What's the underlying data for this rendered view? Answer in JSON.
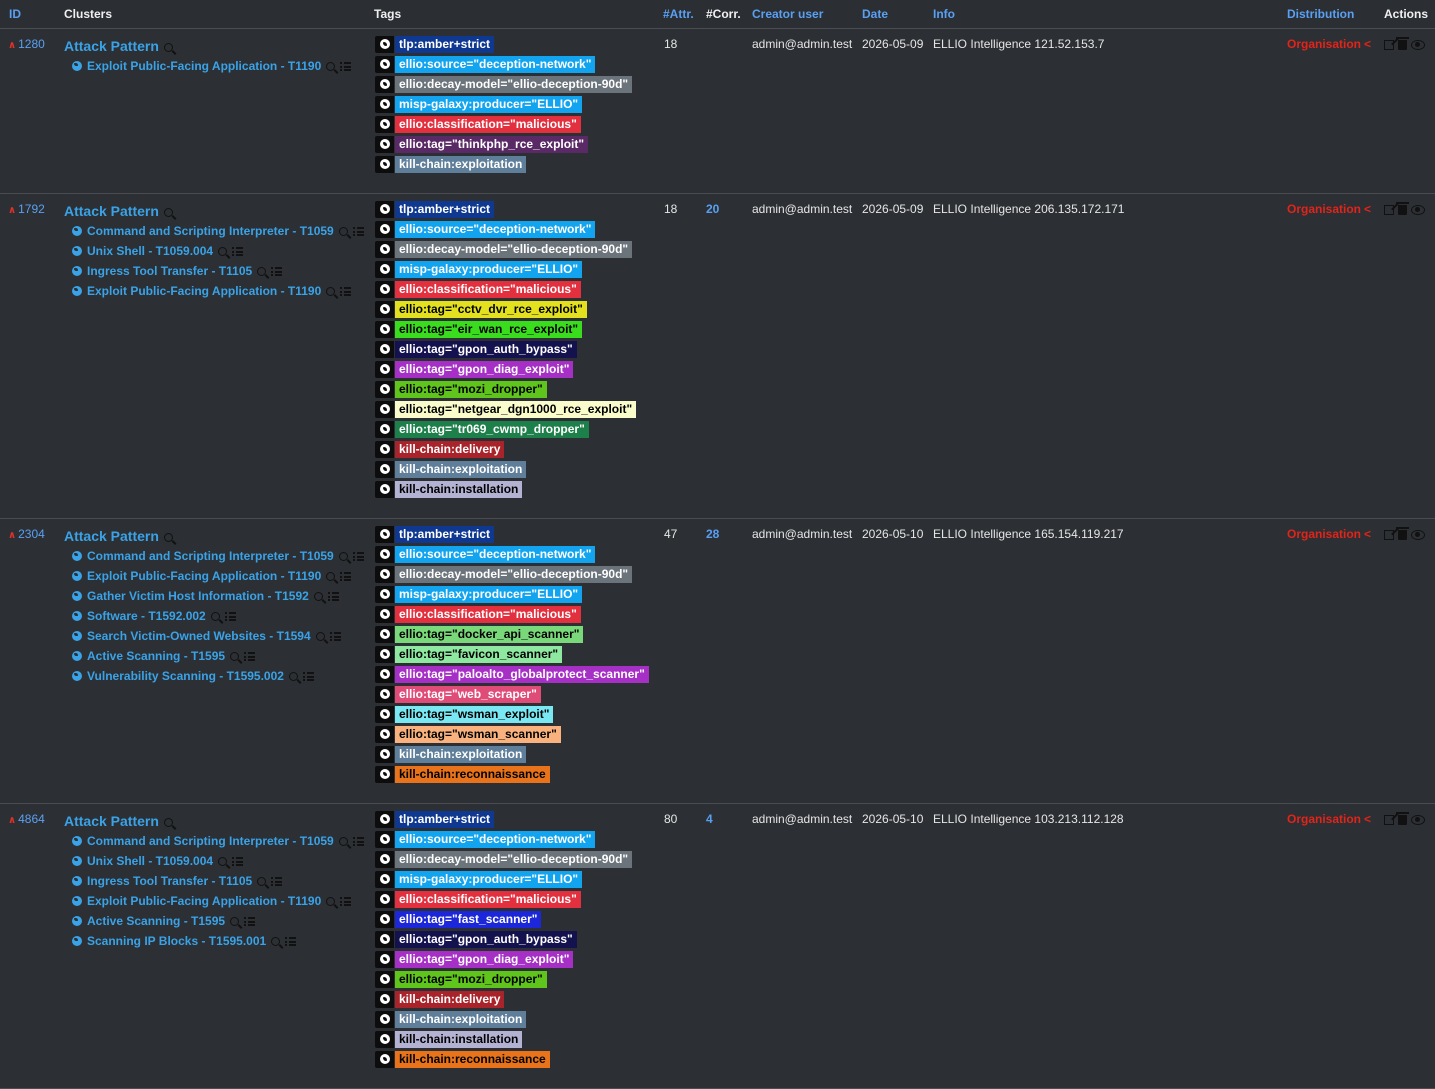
{
  "headers": {
    "id": "ID",
    "clusters": "Clusters",
    "tags": "Tags",
    "attr": "#Attr.",
    "corr": "#Corr.",
    "creator": "Creator user",
    "date": "Date",
    "info": "Info",
    "distribution": "Distribution",
    "actions": "Actions"
  },
  "colors": {
    "accent": "#3aa3e8",
    "link": "#5aa0f2",
    "distribution": "#e2241a",
    "background": "#2c2f33"
  },
  "events": [
    {
      "id": "1280",
      "attr": "18",
      "corr": "",
      "creator": "admin@admin.test",
      "date": "2026-05-09",
      "info": "ELLIO Intelligence 121.52.153.7",
      "distribution": "Organisation",
      "cluster_head": "Attack Pattern",
      "clusters": [
        "Exploit Public-Facing Application - T1190"
      ],
      "tags": [
        {
          "label": "tlp:amber+strict",
          "bg": "#0f3890",
          "fg": "#ffffff"
        },
        {
          "label": "ellio:source=\"deception-network\"",
          "bg": "#12a4ef",
          "fg": "#ffffff"
        },
        {
          "label": "ellio:decay-model=\"ellio-deception-90d\"",
          "bg": "#6b737b",
          "fg": "#ffffff"
        },
        {
          "label": "misp-galaxy:producer=\"ELLIO\"",
          "bg": "#12a4ef",
          "fg": "#ffffff"
        },
        {
          "label": "ellio:classification=\"malicious\"",
          "bg": "#e2303f",
          "fg": "#ffffff"
        },
        {
          "label": "ellio:tag=\"thinkphp_rce_exploit\"",
          "bg": "#5a2a66",
          "fg": "#ffffff"
        },
        {
          "label": "kill-chain:exploitation",
          "bg": "#5f7e9a",
          "fg": "#ffffff"
        }
      ]
    },
    {
      "id": "1792",
      "attr": "18",
      "corr": "20",
      "creator": "admin@admin.test",
      "date": "2026-05-09",
      "info": "ELLIO Intelligence 206.135.172.171",
      "distribution": "Organisation",
      "cluster_head": "Attack Pattern",
      "clusters": [
        "Command and Scripting Interpreter - T1059",
        "Unix Shell - T1059.004",
        "Ingress Tool Transfer - T1105",
        "Exploit Public-Facing Application - T1190"
      ],
      "tags": [
        {
          "label": "tlp:amber+strict",
          "bg": "#0f3890",
          "fg": "#ffffff"
        },
        {
          "label": "ellio:source=\"deception-network\"",
          "bg": "#12a4ef",
          "fg": "#ffffff"
        },
        {
          "label": "ellio:decay-model=\"ellio-deception-90d\"",
          "bg": "#6b737b",
          "fg": "#ffffff"
        },
        {
          "label": "misp-galaxy:producer=\"ELLIO\"",
          "bg": "#12a4ef",
          "fg": "#ffffff"
        },
        {
          "label": "ellio:classification=\"malicious\"",
          "bg": "#e2303f",
          "fg": "#ffffff"
        },
        {
          "label": "ellio:tag=\"cctv_dvr_rce_exploit\"",
          "bg": "#e3e020",
          "fg": "#000000"
        },
        {
          "label": "ellio:tag=\"eir_wan_rce_exploit\"",
          "bg": "#3adc1e",
          "fg": "#000000"
        },
        {
          "label": "ellio:tag=\"gpon_auth_bypass\"",
          "bg": "#13124f",
          "fg": "#ffffff"
        },
        {
          "label": "ellio:tag=\"gpon_diag_exploit\"",
          "bg": "#a62fc6",
          "fg": "#ffffff"
        },
        {
          "label": "ellio:tag=\"mozi_dropper\"",
          "bg": "#5fc41c",
          "fg": "#000000"
        },
        {
          "label": "ellio:tag=\"netgear_dgn1000_rce_exploit\"",
          "bg": "#fbfccb",
          "fg": "#000000"
        },
        {
          "label": "ellio:tag=\"tr069_cwmp_dropper\"",
          "bg": "#1d7f4a",
          "fg": "#ffffff"
        },
        {
          "label": "kill-chain:delivery",
          "bg": "#a8242a",
          "fg": "#ffffff"
        },
        {
          "label": "kill-chain:exploitation",
          "bg": "#5f7e9a",
          "fg": "#ffffff"
        },
        {
          "label": "kill-chain:installation",
          "bg": "#b3b2d2",
          "fg": "#000000"
        }
      ]
    },
    {
      "id": "2304",
      "attr": "47",
      "corr": "28",
      "creator": "admin@admin.test",
      "date": "2026-05-10",
      "info": "ELLIO Intelligence 165.154.119.217",
      "distribution": "Organisation",
      "cluster_head": "Attack Pattern",
      "clusters": [
        "Command and Scripting Interpreter - T1059",
        "Exploit Public-Facing Application - T1190",
        "Gather Victim Host Information - T1592",
        "Software - T1592.002",
        "Search Victim-Owned Websites - T1594",
        "Active Scanning - T1595",
        "Vulnerability Scanning - T1595.002"
      ],
      "tags": [
        {
          "label": "tlp:amber+strict",
          "bg": "#0f3890",
          "fg": "#ffffff"
        },
        {
          "label": "ellio:source=\"deception-network\"",
          "bg": "#12a4ef",
          "fg": "#ffffff"
        },
        {
          "label": "ellio:decay-model=\"ellio-deception-90d\"",
          "bg": "#6b737b",
          "fg": "#ffffff"
        },
        {
          "label": "misp-galaxy:producer=\"ELLIO\"",
          "bg": "#12a4ef",
          "fg": "#ffffff"
        },
        {
          "label": "ellio:classification=\"malicious\"",
          "bg": "#e2303f",
          "fg": "#ffffff"
        },
        {
          "label": "ellio:tag=\"docker_api_scanner\"",
          "bg": "#79d879",
          "fg": "#000000"
        },
        {
          "label": "ellio:tag=\"favicon_scanner\"",
          "bg": "#8ee8a0",
          "fg": "#000000"
        },
        {
          "label": "ellio:tag=\"paloalto_globalprotect_scanner\"",
          "bg": "#a62fc6",
          "fg": "#ffffff"
        },
        {
          "label": "ellio:tag=\"web_scraper\"",
          "bg": "#e04c78",
          "fg": "#ffffff"
        },
        {
          "label": "ellio:tag=\"wsman_exploit\"",
          "bg": "#7ae8f2",
          "fg": "#000000"
        },
        {
          "label": "ellio:tag=\"wsman_scanner\"",
          "bg": "#f9b27d",
          "fg": "#000000"
        },
        {
          "label": "kill-chain:exploitation",
          "bg": "#5f7e9a",
          "fg": "#ffffff"
        },
        {
          "label": "kill-chain:reconnaissance",
          "bg": "#e8731a",
          "fg": "#000000"
        }
      ]
    },
    {
      "id": "4864",
      "attr": "80",
      "corr": "4",
      "creator": "admin@admin.test",
      "date": "2026-05-10",
      "info": "ELLIO Intelligence 103.213.112.128",
      "distribution": "Organisation",
      "cluster_head": "Attack Pattern",
      "clusters": [
        "Command and Scripting Interpreter - T1059",
        "Unix Shell - T1059.004",
        "Ingress Tool Transfer - T1105",
        "Exploit Public-Facing Application - T1190",
        "Active Scanning - T1595",
        "Scanning IP Blocks - T1595.001"
      ],
      "tags": [
        {
          "label": "tlp:amber+strict",
          "bg": "#0f3890",
          "fg": "#ffffff"
        },
        {
          "label": "ellio:source=\"deception-network\"",
          "bg": "#12a4ef",
          "fg": "#ffffff"
        },
        {
          "label": "ellio:decay-model=\"ellio-deception-90d\"",
          "bg": "#6b737b",
          "fg": "#ffffff"
        },
        {
          "label": "misp-galaxy:producer=\"ELLIO\"",
          "bg": "#12a4ef",
          "fg": "#ffffff"
        },
        {
          "label": "ellio:classification=\"malicious\"",
          "bg": "#e2303f",
          "fg": "#ffffff"
        },
        {
          "label": "ellio:tag=\"fast_scanner\"",
          "bg": "#1b27d8",
          "fg": "#ffffff"
        },
        {
          "label": "ellio:tag=\"gpon_auth_bypass\"",
          "bg": "#13124f",
          "fg": "#ffffff"
        },
        {
          "label": "ellio:tag=\"gpon_diag_exploit\"",
          "bg": "#a62fc6",
          "fg": "#ffffff"
        },
        {
          "label": "ellio:tag=\"mozi_dropper\"",
          "bg": "#5fc41c",
          "fg": "#000000"
        },
        {
          "label": "kill-chain:delivery",
          "bg": "#a8242a",
          "fg": "#ffffff"
        },
        {
          "label": "kill-chain:exploitation",
          "bg": "#5f7e9a",
          "fg": "#ffffff"
        },
        {
          "label": "kill-chain:installation",
          "bg": "#b3b2d2",
          "fg": "#000000"
        },
        {
          "label": "kill-chain:reconnaissance",
          "bg": "#e8731a",
          "fg": "#000000"
        }
      ]
    }
  ]
}
